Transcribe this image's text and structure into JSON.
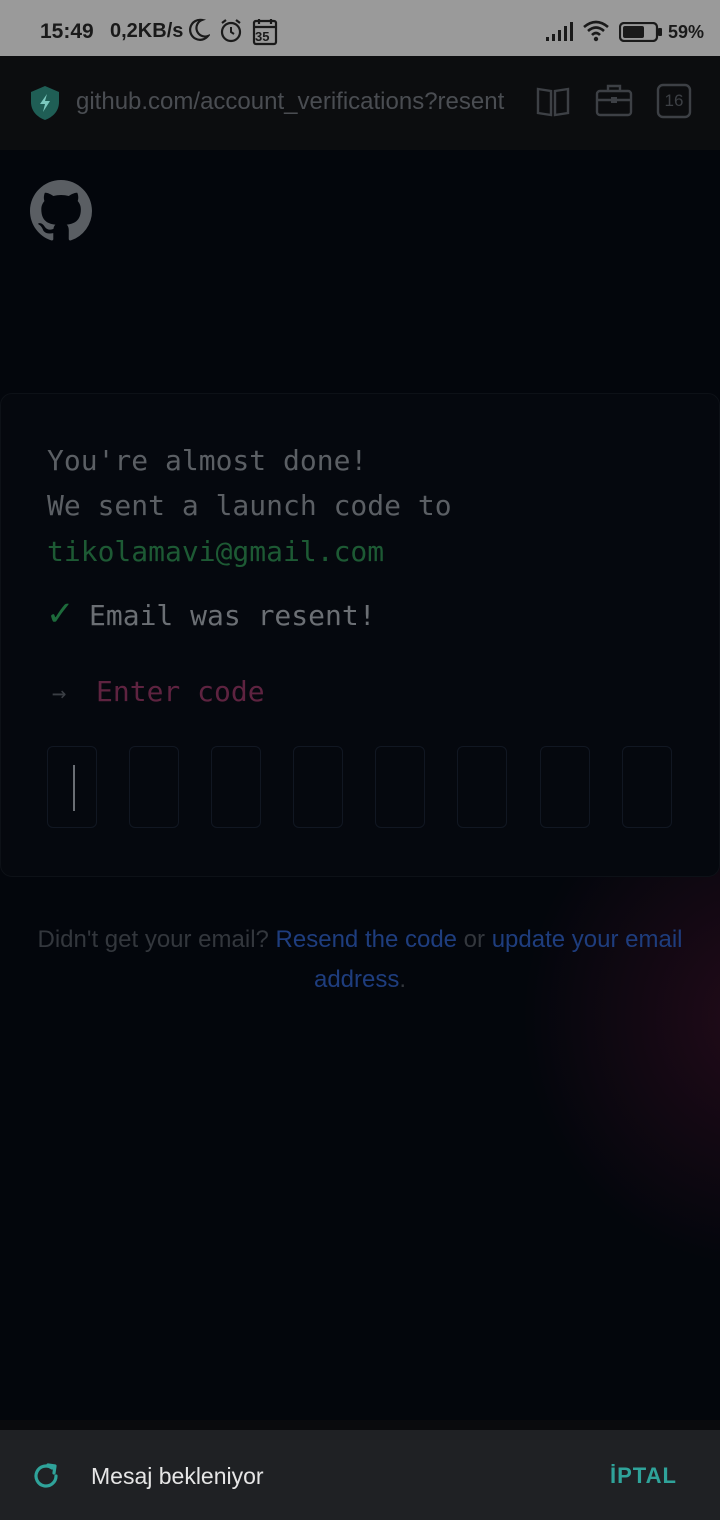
{
  "status_bar": {
    "time": "15:49",
    "net_speed": "0,2KB/s",
    "calendar_badge": "35",
    "battery_percent": "59%",
    "icons": [
      "moon-icon",
      "alarm-icon",
      "calendar-icon",
      "signal-icon",
      "wifi-icon",
      "battery-icon"
    ]
  },
  "browser": {
    "url": "github.com/account_verifications?resent",
    "tab_count": "16",
    "icons": [
      "shield-lightning-icon",
      "book-icon",
      "briefcase-icon",
      "tab-count-icon"
    ]
  },
  "page": {
    "logo": "github-logo",
    "line1": "You're almost done!",
    "line2": "We sent a launch code to",
    "email": "tikolamavi@gmail.com",
    "checkmark": "✓",
    "resent_message": "Email was resent!",
    "arrow": "→",
    "enter_code_label": "Enter code",
    "code_box_count": 8,
    "help_prefix": "Didn't get your email? ",
    "resend_link": "Resend the code",
    "help_or": " or ",
    "update_link": "update your email address",
    "help_suffix": "."
  },
  "bottom_sheet": {
    "message": "Mesaj bekleniyor",
    "cancel_label": "İPTAL",
    "icon": "refresh-icon"
  },
  "colors": {
    "background": "#03060c",
    "accent_green": "#1d6b3b",
    "link_blue": "#1e3d7e",
    "enter_code_red": "#5e2340",
    "cancel_teal": "#2fa39a"
  }
}
